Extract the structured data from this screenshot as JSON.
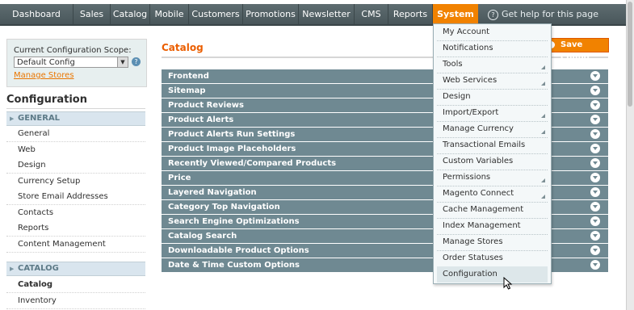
{
  "nav": {
    "items": [
      "Dashboard",
      "Sales",
      "Catalog",
      "Mobile",
      "Customers",
      "Promotions",
      "Newsletter",
      "CMS",
      "Reports",
      "System"
    ],
    "active": "System",
    "help_text": "Get help for this page"
  },
  "scope": {
    "label": "Current Configuration Scope:",
    "selected": "Default Config",
    "manage_stores": "Manage Stores"
  },
  "left": {
    "title": "Configuration",
    "groups": [
      {
        "heading": "GENERAL",
        "items": [
          "General",
          "Web",
          "Design",
          "Currency Setup",
          "Store Email Addresses",
          "Contacts",
          "Reports",
          "Content Management"
        ]
      },
      {
        "heading": "CATALOG",
        "items": [
          "Catalog",
          "Inventory"
        ]
      }
    ],
    "selected_item": "Catalog"
  },
  "main": {
    "title": "Catalog",
    "save_label": "Save Config",
    "sections": [
      "Frontend",
      "Sitemap",
      "Product Reviews",
      "Product Alerts",
      "Product Alerts Run Settings",
      "Product Image Placeholders",
      "Recently Viewed/Compared Products",
      "Price",
      "Layered Navigation",
      "Category Top Navigation",
      "Search Engine Optimizations",
      "Catalog Search",
      "Downloadable Product Options",
      "Date & Time Custom Options"
    ]
  },
  "system_menu": {
    "items": [
      {
        "label": "My Account",
        "submenu": false
      },
      {
        "label": "Notifications",
        "submenu": false
      },
      {
        "label": "Tools",
        "submenu": true
      },
      {
        "label": "Web Services",
        "submenu": true
      },
      {
        "label": "Design",
        "submenu": false
      },
      {
        "label": "Import/Export",
        "submenu": true
      },
      {
        "label": "Manage Currency",
        "submenu": true
      },
      {
        "label": "Transactional Emails",
        "submenu": false
      },
      {
        "label": "Custom Variables",
        "submenu": false
      },
      {
        "label": "Permissions",
        "submenu": true
      },
      {
        "label": "Magento Connect",
        "submenu": true
      },
      {
        "label": "Cache Management",
        "submenu": false
      },
      {
        "label": "Index Management",
        "submenu": false
      },
      {
        "label": "Manage Stores",
        "submenu": false
      },
      {
        "label": "Order Statuses",
        "submenu": false
      },
      {
        "label": "Configuration",
        "submenu": false
      }
    ],
    "hovered": "Configuration"
  },
  "colors": {
    "accent": "#f18200",
    "nav_bg": "#55646a",
    "section_bg": "#6f8992",
    "title_orange": "#eb5e00"
  }
}
